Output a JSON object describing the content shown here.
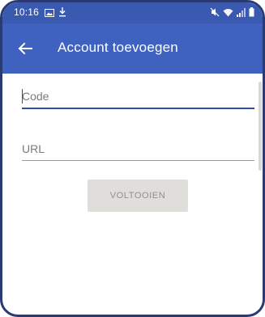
{
  "status_bar": {
    "time": "10:16",
    "left_icons": [
      "image-icon",
      "download-icon"
    ],
    "right_icons": [
      "mute-icon",
      "wifi-icon",
      "signal-icon",
      "battery-icon"
    ]
  },
  "app_bar": {
    "title": "Account toevoegen",
    "back_icon": "arrow-left-icon",
    "color": "#3f62c0"
  },
  "form": {
    "code_placeholder": "Code",
    "url_placeholder": "URL",
    "submit_label": "VOLTOOIEN"
  },
  "colors": {
    "status_bar": "#3a5ab2",
    "accent": "#2e4da6",
    "button_bg": "#e0dedb"
  }
}
